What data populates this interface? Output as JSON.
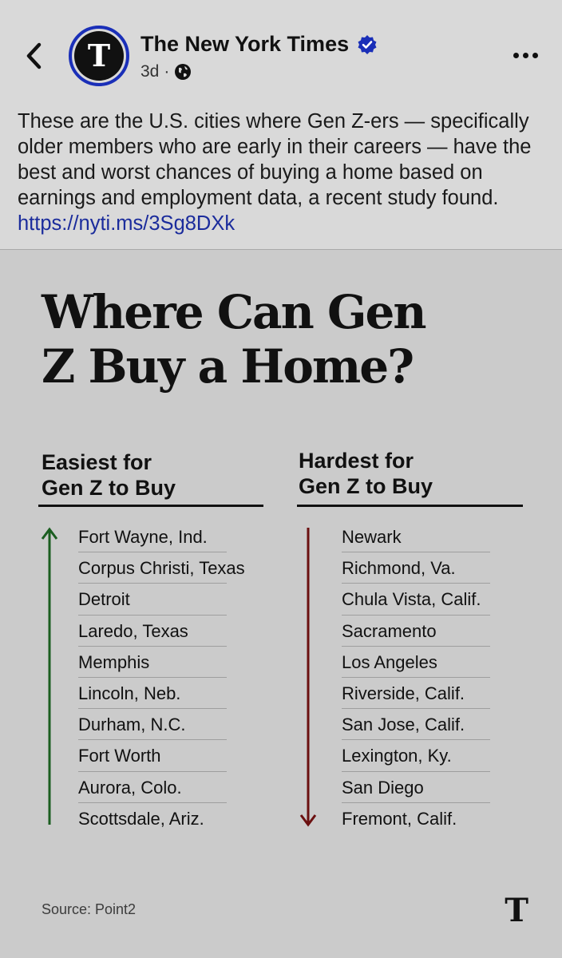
{
  "post": {
    "page_name": "The New York Times",
    "time": "3d",
    "dot": "·",
    "caption": "These are the U.S. cities where Gen Z-ers — specifically older members who are early in their careers — have the best and worst chances of buying a home based on earnings and employment data, a recent study found.",
    "link": "https://nyti.ms/3Sg8DXk",
    "avatar_letter": "T",
    "icons": {
      "back": "chevron-left-icon",
      "verified": "verified-badge-icon",
      "audience": "globe-icon",
      "more": "more-options-icon"
    },
    "colors": {
      "verified": "#1a2fb8",
      "link": "#1b2c9c"
    }
  },
  "graphic": {
    "title": "Where Can Gen Z Buy a Home?",
    "easiest": {
      "heading_line1": "Easiest for",
      "heading_line2": "Gen Z to Buy",
      "arrow_color": "#1b5e20",
      "cities": [
        "Fort Wayne, Ind.",
        "Corpus Christi, Texas",
        "Detroit",
        "Laredo, Texas",
        "Memphis",
        "Lincoln, Neb.",
        "Durham, N.C.",
        "Fort Worth",
        "Aurora, Colo.",
        "Scottsdale, Ariz."
      ]
    },
    "hardest": {
      "heading_line1": "Hardest for",
      "heading_line2": "Gen Z to Buy",
      "arrow_color": "#6b1010",
      "cities": [
        "Newark",
        "Richmond, Va.",
        "Chula Vista, Calif.",
        "Sacramento",
        "Los Angeles",
        "Riverside, Calif.",
        "San Jose, Calif.",
        "Lexington, Ky.",
        "San Diego",
        "Fremont, Calif."
      ]
    },
    "source": "Source: Point2",
    "logo_letter": "T"
  }
}
